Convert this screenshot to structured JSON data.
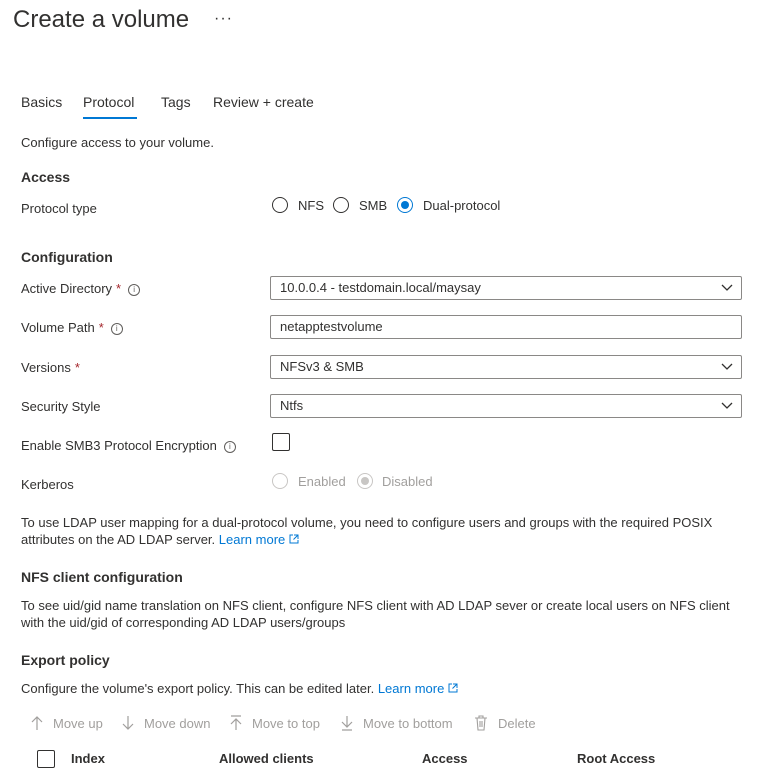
{
  "header": {
    "title": "Create a volume",
    "more": "···"
  },
  "tabs": [
    {
      "label": "Basics"
    },
    {
      "label": "Protocol"
    },
    {
      "label": "Tags"
    },
    {
      "label": "Review + create"
    }
  ],
  "intro": "Configure access to your volume.",
  "access": {
    "heading": "Access",
    "protocol_type_label": "Protocol type",
    "options": [
      "NFS",
      "SMB",
      "Dual-protocol"
    ],
    "selected": "Dual-protocol"
  },
  "configuration": {
    "heading": "Configuration",
    "active_directory": {
      "label": "Active Directory",
      "required": "*",
      "value": "10.0.0.4 - testdomain.local/maysay"
    },
    "volume_path": {
      "label": "Volume Path",
      "required": "*",
      "value": "netapptestvolume"
    },
    "versions": {
      "label": "Versions",
      "required": "*",
      "value": "NFSv3 & SMB"
    },
    "security_style": {
      "label": "Security Style",
      "value": "Ntfs"
    },
    "smb3_encryption": {
      "label": "Enable SMB3 Protocol Encryption",
      "checked": false
    },
    "kerberos": {
      "label": "Kerberos",
      "options": [
        "Enabled",
        "Disabled"
      ],
      "selected": "Disabled"
    }
  },
  "ldap_note": {
    "line1": "To use LDAP user mapping for a dual-protocol volume, you need to configure users and groups with the required POSIX",
    "line2": "attributes on the AD LDAP server.",
    "link": "Learn more"
  },
  "nfs_client": {
    "heading": "NFS client configuration",
    "line1": "To see uid/gid name translation on NFS client, configure NFS client with AD LDAP sever or create local users on NFS client",
    "line2": "with the uid/gid of corresponding AD LDAP users/groups"
  },
  "export_policy": {
    "heading": "Export policy",
    "text": "Configure the volume's export policy. This can be edited later.",
    "link": "Learn more",
    "toolbar": {
      "move_up": "Move up",
      "move_down": "Move down",
      "move_to_top": "Move to top",
      "move_to_bottom": "Move to bottom",
      "delete": "Delete"
    },
    "columns": [
      "Index",
      "Allowed clients",
      "Access",
      "Root Access"
    ]
  },
  "colors": {
    "accent": "#0078d4",
    "required": "#a4262c",
    "disabled": "#a19f9d"
  }
}
